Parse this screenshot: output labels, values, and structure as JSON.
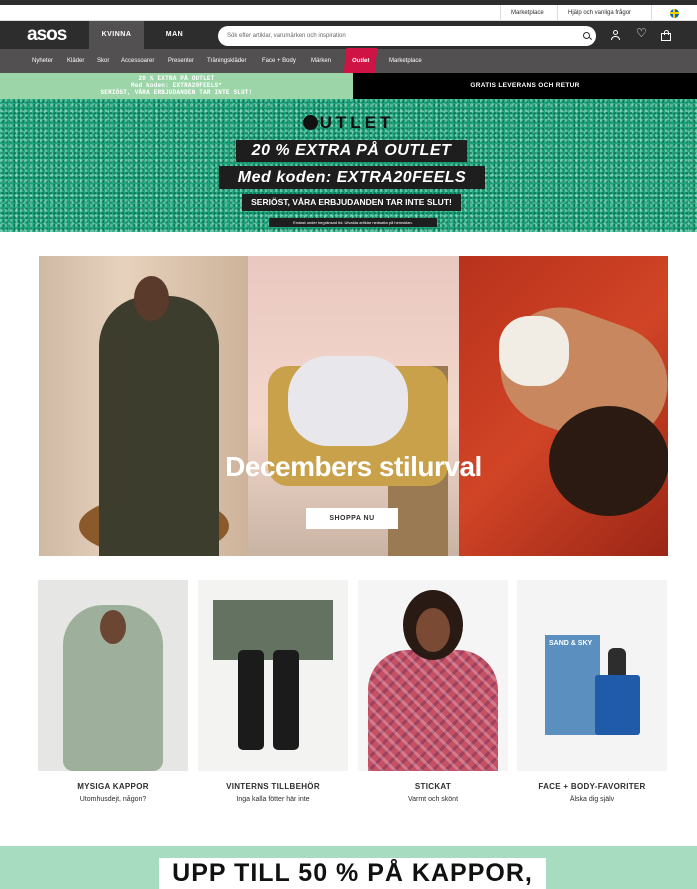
{
  "utility": {
    "marketplace": "Marketplace",
    "help": "Hjälp och vanliga frågor"
  },
  "header": {
    "logo": "asos",
    "gender_tabs": [
      "KVINNA",
      "MAN"
    ],
    "search_placeholder": "Sök efter artiklar, varumärken och inspiration"
  },
  "categories": [
    "Nyheter",
    "Kläder",
    "Skor",
    "Accessoarer",
    "Presenter",
    "Träningskläder",
    "Face + Body",
    "Märken",
    "Outlet",
    "Marketplace"
  ],
  "promo": {
    "left_line1": "20 % EXTRA PÅ OUTLET",
    "left_line2": "Med koden: EXTRA20FEELS*",
    "left_line3": "SERIÖST, VÅRA ERBJUDANDEN TAR INTE SLUT!",
    "right": "GRATIS LEVERANS OCH RETUR"
  },
  "banner": {
    "title": "UTLET",
    "line1": "20 % EXTRA PÅ OUTLET",
    "line2": "Med koden: EXTRA20FEELS",
    "line3": "SERIÖST, VÅRA ERBJUDANDEN TAR INTE SLUT!",
    "fineprint": "Endast under begränsad tid. Utvalda artiklar nedsatta på hemsidan."
  },
  "hero": {
    "title": "Decembers stilurval",
    "button": "SHOPPA NU"
  },
  "tiles": [
    {
      "title": "MYSIGA KAPPOR",
      "subtitle": "Utomhusdejt, någon?"
    },
    {
      "title": "VINTERNS TILLBEHÖR",
      "subtitle": "Inga kalla fötter här inte"
    },
    {
      "title": "STICKAT",
      "subtitle": "Varmt och skönt"
    },
    {
      "title": "FACE + BODY-FAVORITER",
      "subtitle": "Älska dig själv"
    }
  ],
  "product_box_text": "SAND & SKY",
  "bottom_banner": "UPP TILL 50 % PÅ KAPPOR,"
}
